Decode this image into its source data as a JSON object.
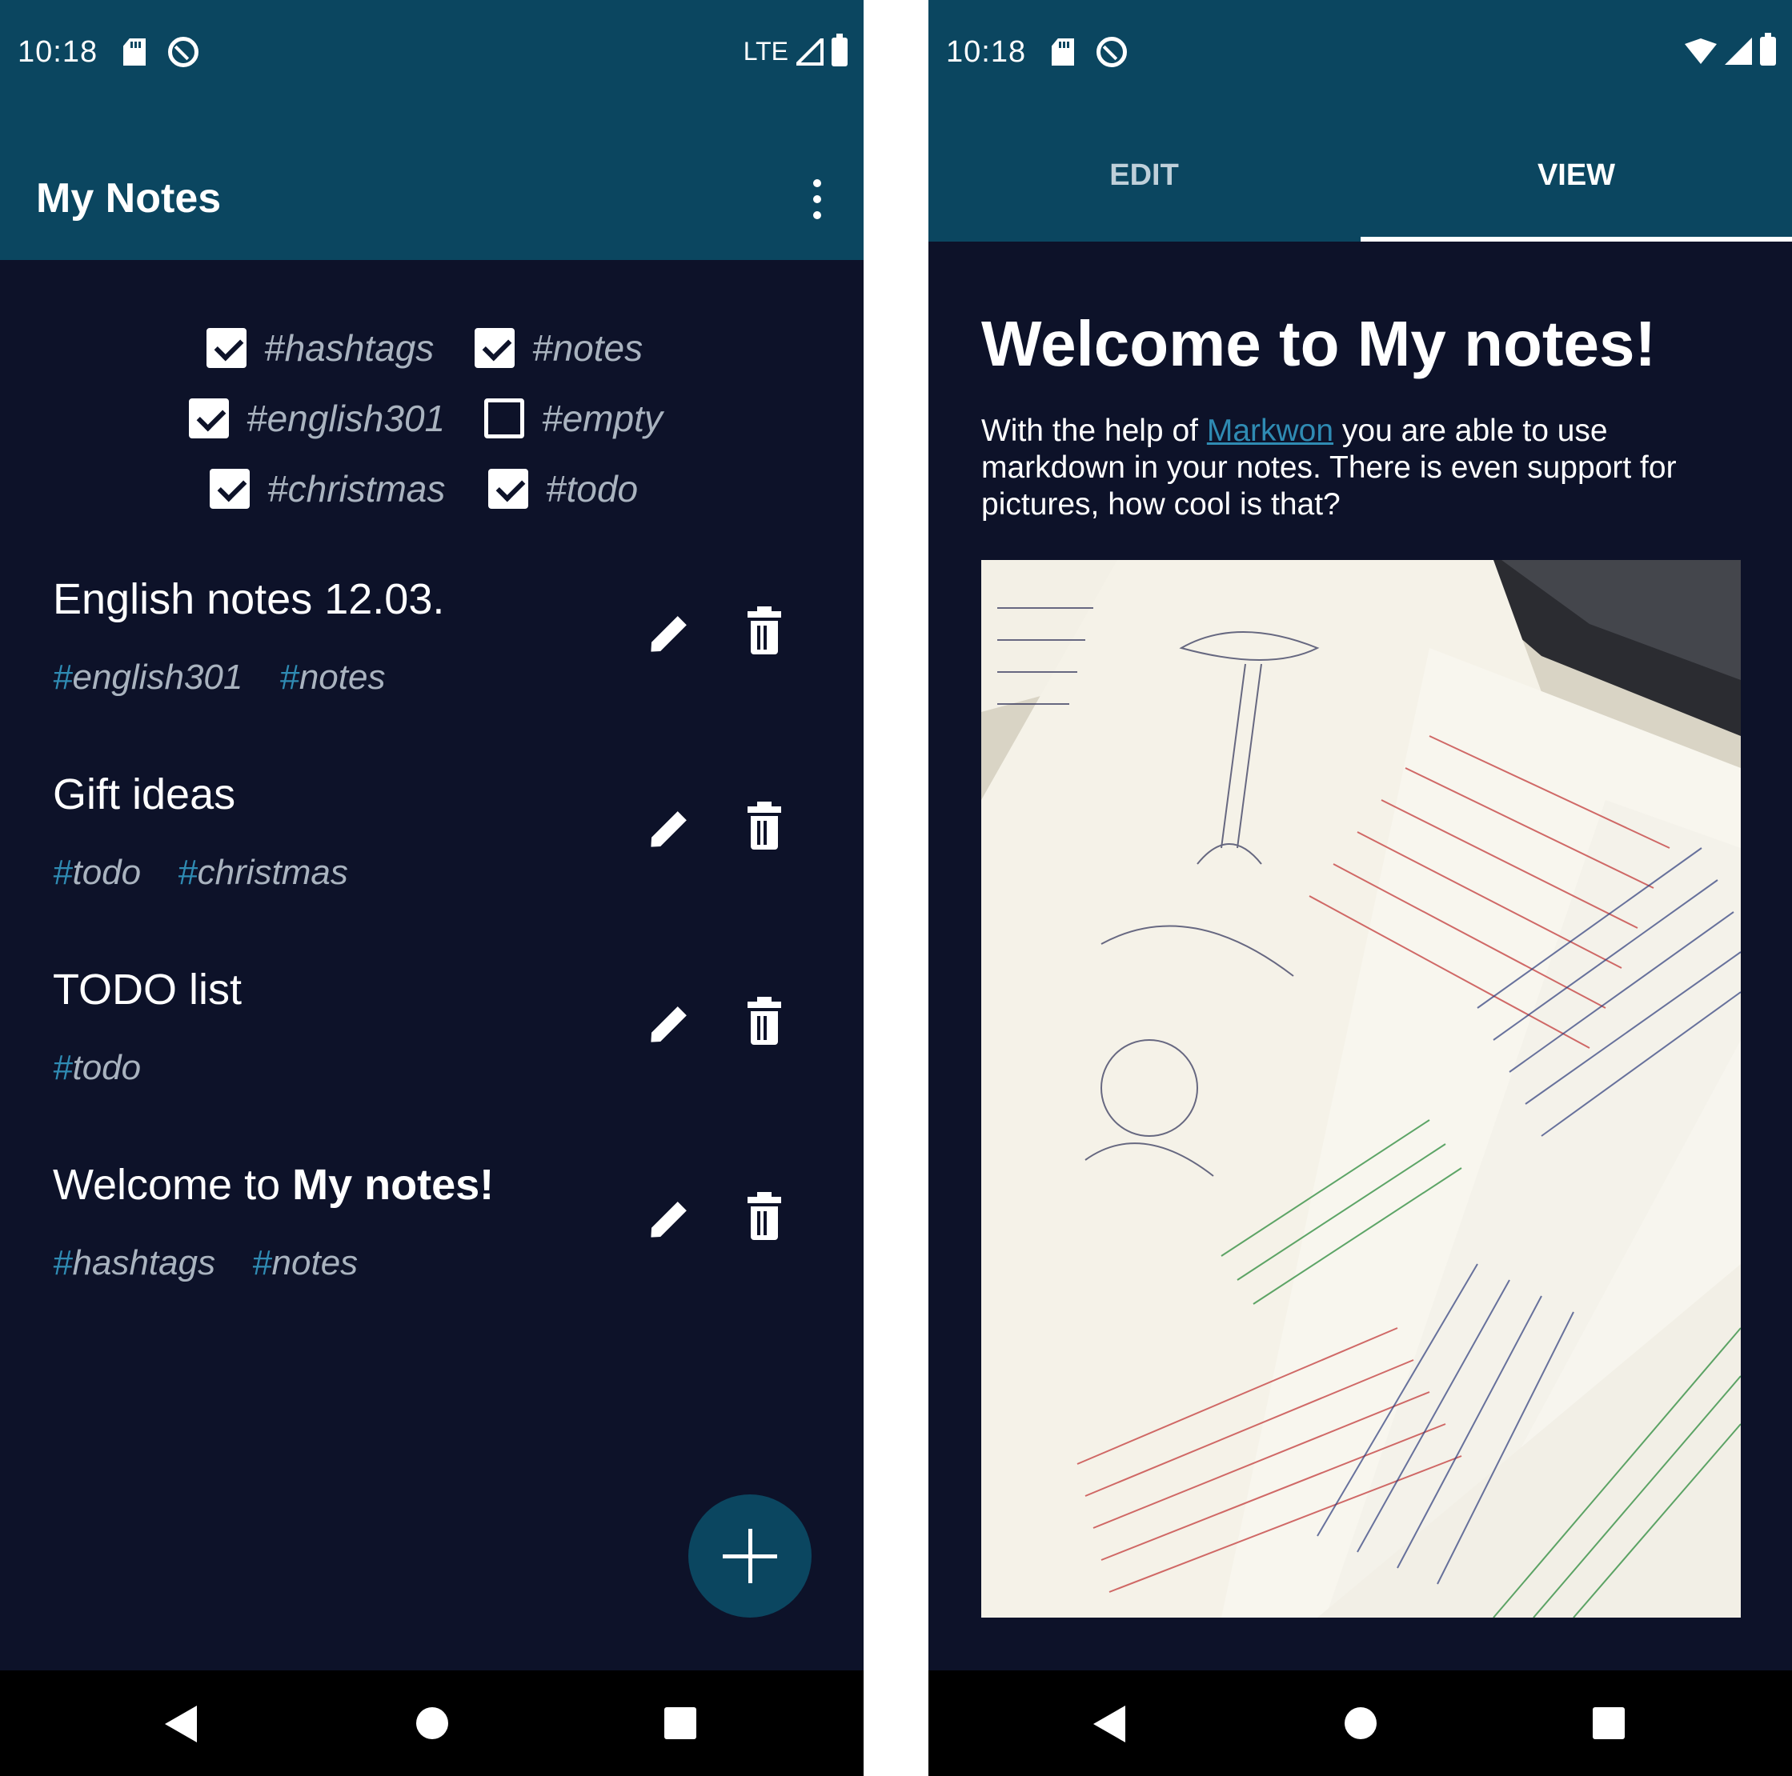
{
  "status_bar": {
    "time": "10:18",
    "lte_label": "LTE",
    "icons_left": [
      "sd-card-icon",
      "sync-icon"
    ],
    "icons_right_left_phone": [
      "lte-signal-icon",
      "battery-icon"
    ],
    "icons_right_right_phone": [
      "wifi-icon",
      "signal-icon",
      "battery-icon"
    ]
  },
  "notes_screen": {
    "app_title": "My Notes",
    "menu_icon": "overflow-menu-icon",
    "filters": [
      {
        "label": "#hashtags",
        "checked": true
      },
      {
        "label": "#notes",
        "checked": true
      },
      {
        "label": "#english301",
        "checked": true
      },
      {
        "label": "#empty",
        "checked": false
      },
      {
        "label": "#christmas",
        "checked": true
      },
      {
        "label": "#todo",
        "checked": true
      }
    ],
    "notes": [
      {
        "title": "English notes 12.03.",
        "tags": [
          "english301",
          "notes"
        ]
      },
      {
        "title": "Gift ideas",
        "tags": [
          "todo",
          "christmas"
        ]
      },
      {
        "title": "TODO list",
        "tags": [
          "todo"
        ]
      },
      {
        "title_prefix": "Welcome to ",
        "title_bold": "My notes!",
        "tags": [
          "hashtags",
          "notes"
        ]
      }
    ],
    "tag_prefix": "#",
    "fab_icon": "plus-icon"
  },
  "viewer_screen": {
    "tabs": [
      {
        "label": "EDIT",
        "active": false
      },
      {
        "label": "VIEW",
        "active": true
      }
    ],
    "heading": "Welcome to My notes!",
    "paragraph_before_link": "With the help of ",
    "link_text": "Markwon",
    "paragraph_after_link": " you are able to use markdown in your notes. There is even support for pictures, how cool is that?",
    "image_description_icon": "handwritten-notes-photo"
  },
  "nav_bar": {
    "icons": [
      "back-icon",
      "home-icon",
      "recents-icon"
    ]
  },
  "colors": {
    "primary": "#0b4660",
    "background": "#0d1229",
    "tag_hash": "#2f8bb3",
    "tag_text": "#a9b3bf",
    "link": "#2f8bb3"
  }
}
